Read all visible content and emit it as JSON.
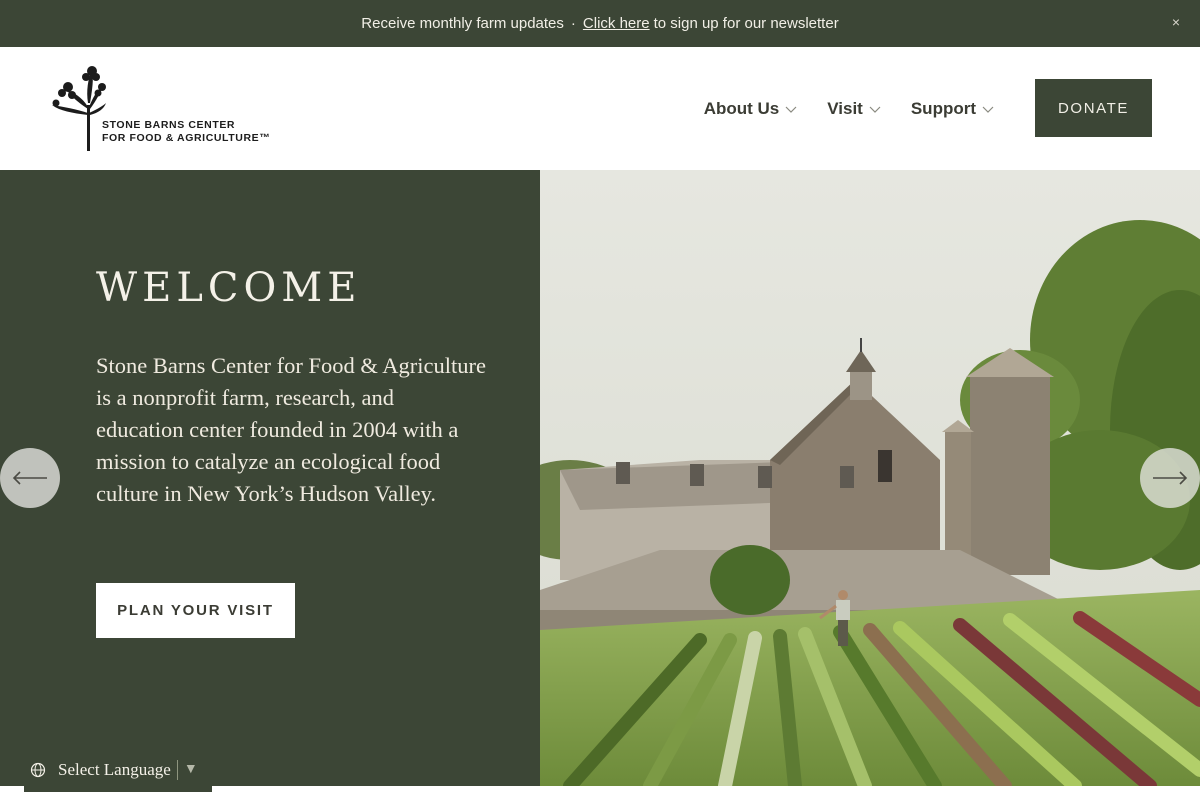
{
  "announcement": {
    "text": "Receive monthly farm updates",
    "separator": "·",
    "link": "Click here",
    "suffix": "to sign up for our newsletter",
    "close": "×"
  },
  "logo": {
    "line1": "STONE BARNS CENTER",
    "line2": "FOR FOOD & AGRICULTURE™"
  },
  "nav": {
    "items": [
      {
        "label": "About Us"
      },
      {
        "label": "Visit"
      },
      {
        "label": "Support"
      }
    ],
    "donate": "DONATE"
  },
  "hero": {
    "title": "WELCOME",
    "body": "Stone Barns Center for Food & Agriculture is a nonprofit farm, research, and education center founded in 2004 with a mission to catalyze an ecological food culture in New York’s Hudson Valley.",
    "cta": "PLAN YOUR VISIT"
  },
  "language": {
    "label": "Select Language",
    "caret": "▼"
  },
  "colors": {
    "brand_green": "#3c4636",
    "cream": "#f1efe6"
  },
  "icons": [
    "close-icon",
    "chevron-down-icon",
    "arrow-left-icon",
    "arrow-right-icon",
    "globe-icon"
  ]
}
